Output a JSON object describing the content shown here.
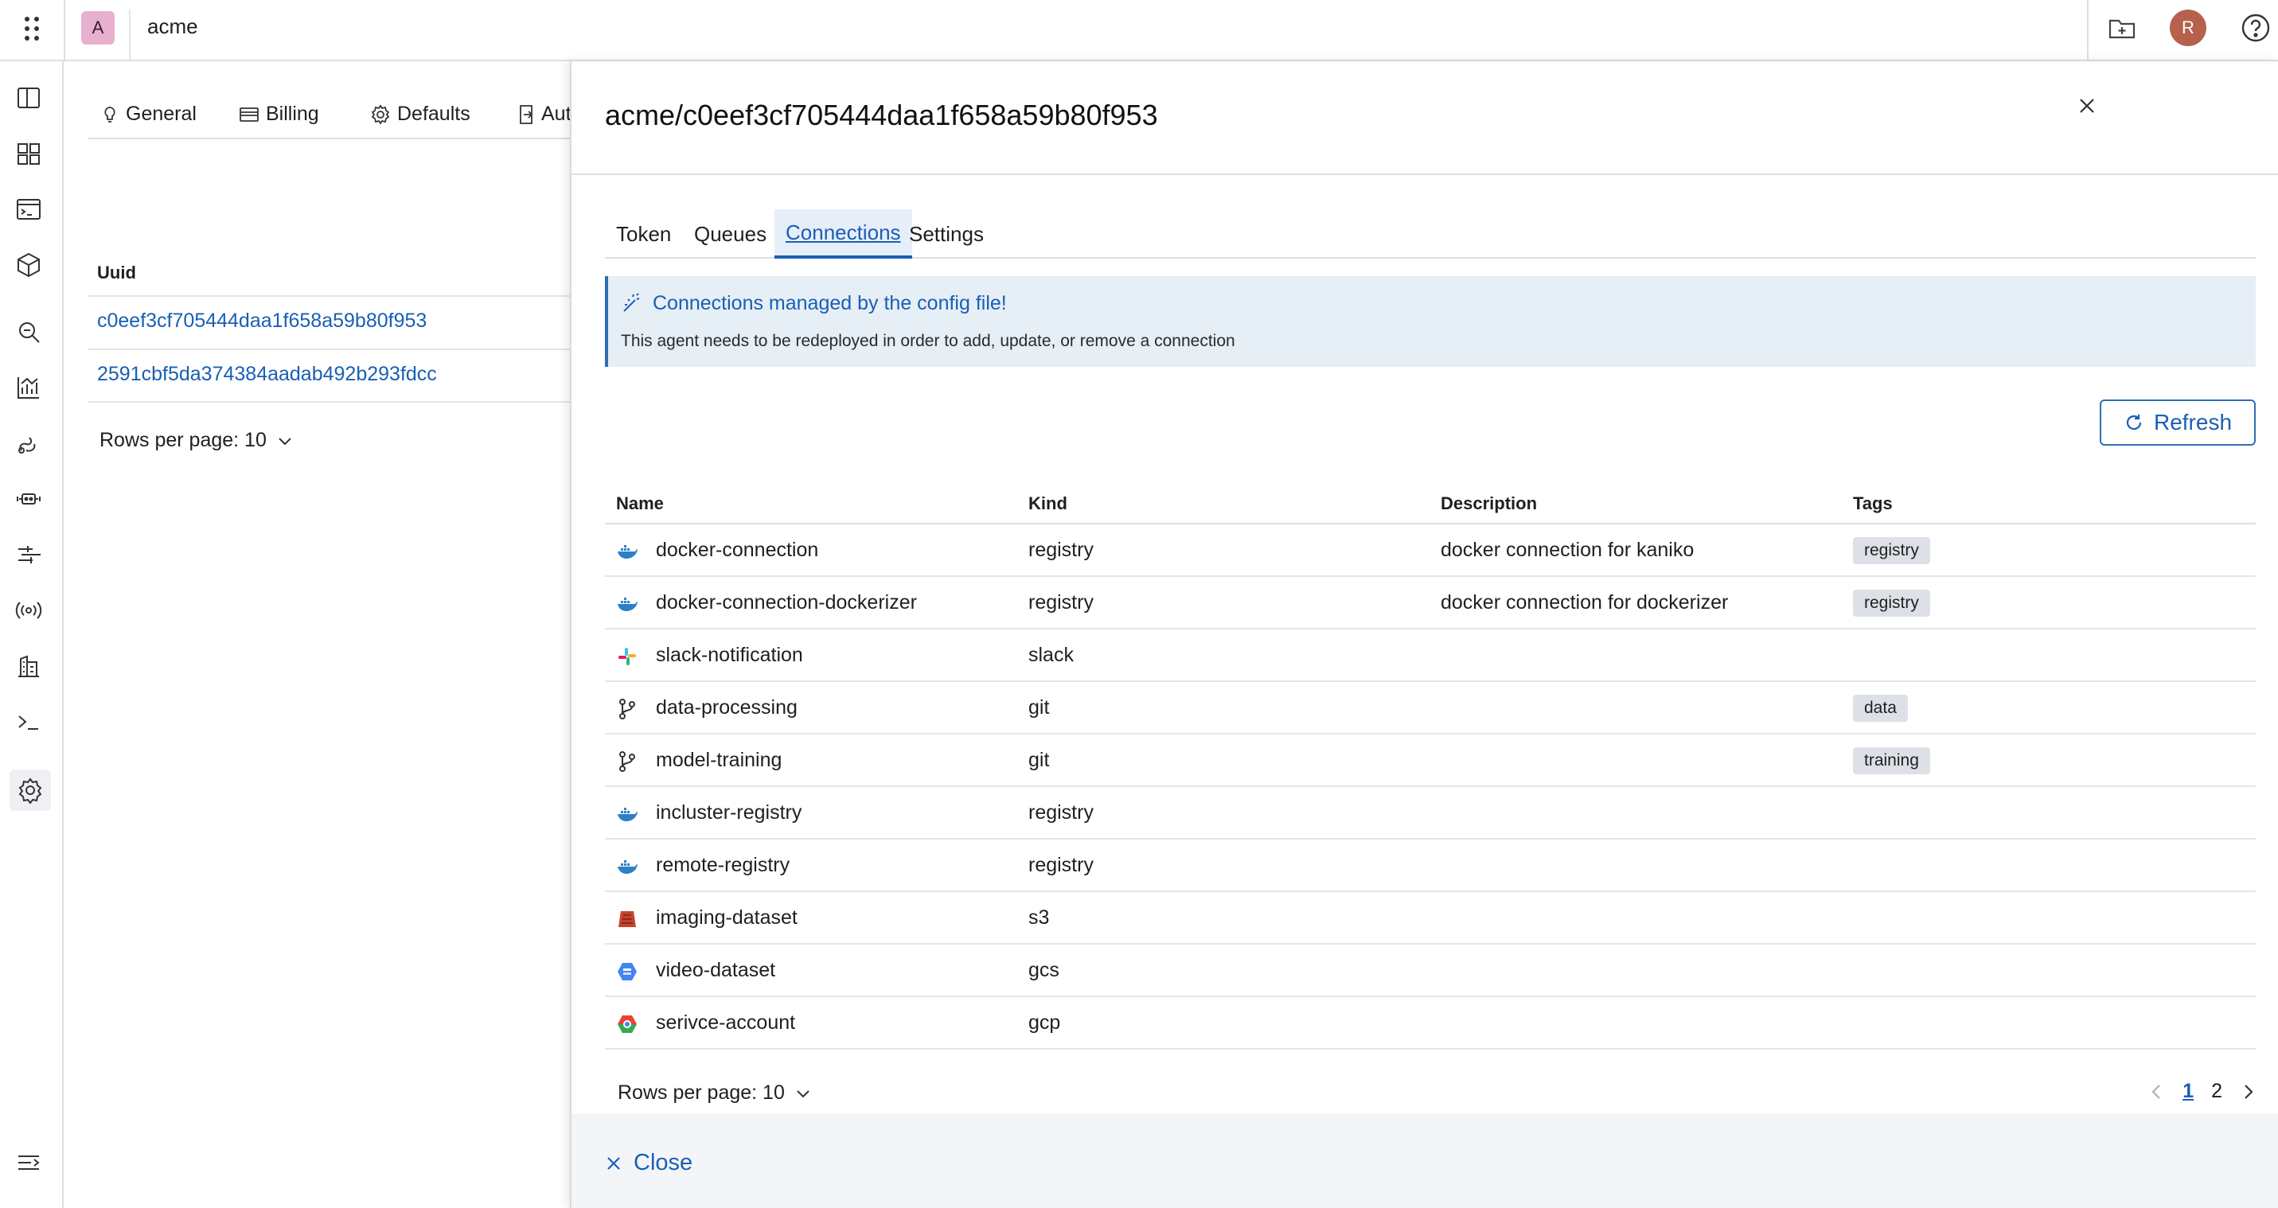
{
  "topbar": {
    "org_initial": "A",
    "org_name": "acme",
    "user_initial": "R"
  },
  "leftnav": {
    "icons": [
      "panel-icon",
      "dashboard-icon",
      "console-icon",
      "package-icon",
      "search-icon",
      "analytics-icon",
      "pipelines-icon",
      "agents-icon",
      "flows-icon",
      "signal-icon",
      "org-icon",
      "terminal-icon",
      "settings-icon",
      "collapse-icon"
    ]
  },
  "settings_page": {
    "tabs": [
      "General",
      "Billing",
      "Defaults",
      "Auth"
    ],
    "uuid_header": "Uuid",
    "uuids": [
      "c0eef3cf705444daa1f658a59b80f953",
      "2591cbf5da374384aadab492b293fdcc"
    ],
    "rows_per_page_label": "Rows per page: 10"
  },
  "drawer": {
    "title": "acme/c0eef3cf705444daa1f658a59b80f953",
    "tabs": [
      "Token",
      "Queues",
      "Connections",
      "Settings"
    ],
    "active_tab": "Connections",
    "callout": {
      "title": "Connections managed by the config file!",
      "body": "This agent needs to be redeployed in order to add, update, or remove a connection"
    },
    "refresh_label": "Refresh",
    "columns": [
      "Name",
      "Kind",
      "Description",
      "Tags"
    ],
    "rows": [
      {
        "icon": "docker-icon",
        "name": "docker-connection",
        "kind": "registry",
        "description": "docker connection for kaniko",
        "tag": "registry"
      },
      {
        "icon": "docker-icon",
        "name": "docker-connection-dockerizer",
        "kind": "registry",
        "description": "docker connection for dockerizer",
        "tag": "registry"
      },
      {
        "icon": "slack-icon",
        "name": "slack-notification",
        "kind": "slack",
        "description": "",
        "tag": ""
      },
      {
        "icon": "git-branch-icon",
        "name": "data-processing",
        "kind": "git",
        "description": "",
        "tag": "data"
      },
      {
        "icon": "git-branch-icon",
        "name": "model-training",
        "kind": "git",
        "description": "",
        "tag": "training"
      },
      {
        "icon": "docker-icon",
        "name": "incluster-registry",
        "kind": "registry",
        "description": "",
        "tag": ""
      },
      {
        "icon": "docker-icon",
        "name": "remote-registry",
        "kind": "registry",
        "description": "",
        "tag": ""
      },
      {
        "icon": "s3-icon",
        "name": "imaging-dataset",
        "kind": "s3",
        "description": "",
        "tag": ""
      },
      {
        "icon": "gcs-icon",
        "name": "video-dataset",
        "kind": "gcs",
        "description": "",
        "tag": ""
      },
      {
        "icon": "gcp-icon",
        "name": "serivce-account",
        "kind": "gcp",
        "description": "",
        "tag": ""
      }
    ],
    "rows_per_page_label": "Rows per page: 10",
    "pages": [
      "1",
      "2"
    ],
    "current_page": "1",
    "close_label": "Close"
  },
  "colors": {
    "accent": "#1a5fb4",
    "callout_bg": "#e6eef6",
    "tag_bg": "#dde1e7",
    "user_avatar": "#b5614b",
    "org_avatar": "#e7b0cf"
  }
}
